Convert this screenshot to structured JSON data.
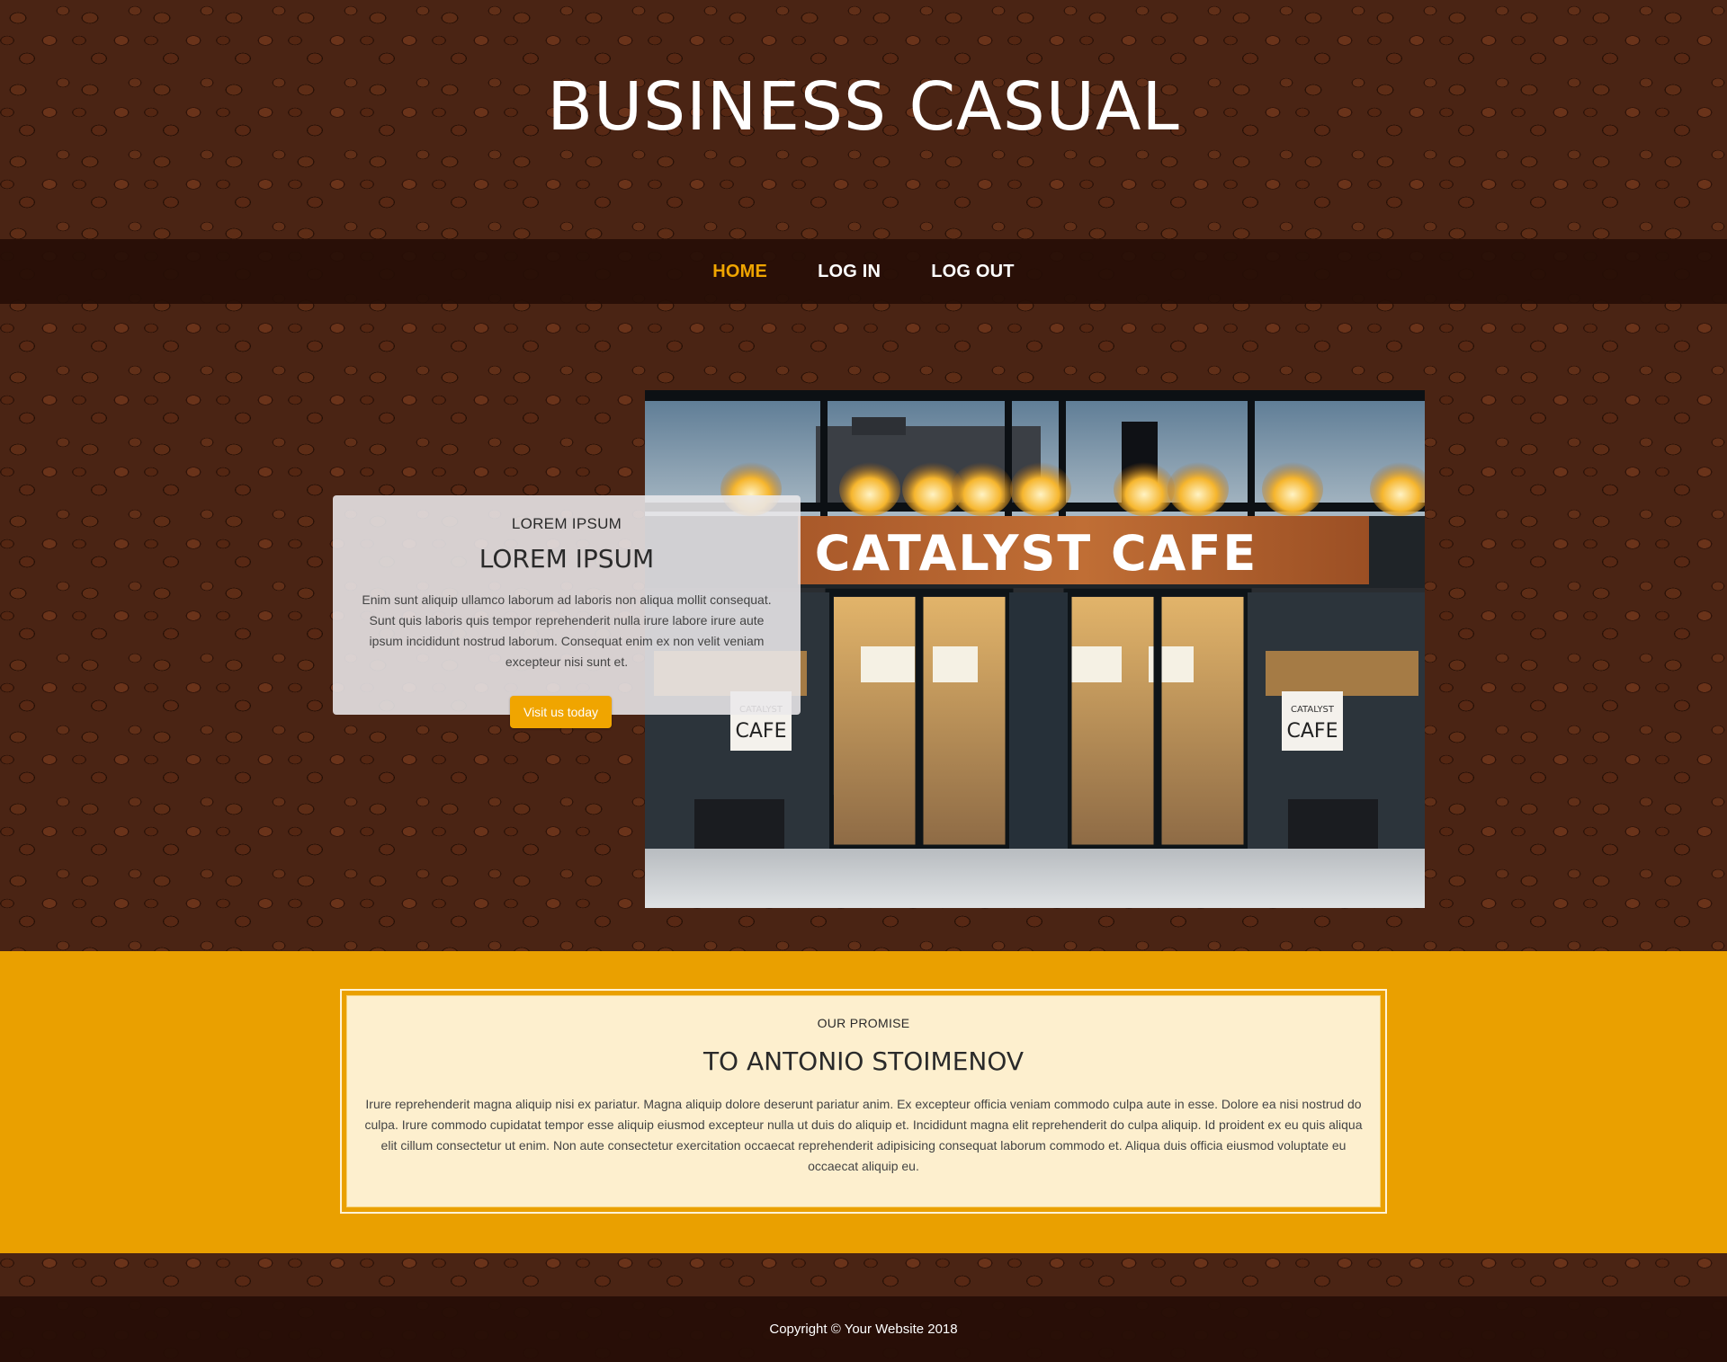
{
  "site": {
    "title": "BUSINESS CASUAL"
  },
  "nav": {
    "items": [
      {
        "label": "HOME",
        "active": true
      },
      {
        "label": "LOG IN",
        "active": false
      },
      {
        "label": "LOG OUT",
        "active": false
      }
    ]
  },
  "intro": {
    "subheading": "LOREM IPSUM",
    "heading": "LOREM IPSUM",
    "text": "Enim sunt aliquip ullamco laborum ad laboris non aliqua mollit consequat. Sunt quis laboris quis tempor reprehenderit nulla irure labore irure aute ipsum incididunt nostrud laborum. Consequat enim ex non velit veniam excepteur nisi sunt et.",
    "button_label": "Visit us today",
    "image": {
      "sign_text": "CATALYST CAFE",
      "window_sign_top": "CATALYST",
      "window_sign_bottom": "CAFE"
    }
  },
  "promise": {
    "subheading": "OUR PROMISE",
    "heading": "TO ANTONIO STOIMENOV",
    "text": "Irure reprehenderit magna aliquip nisi ex pariatur. Magna aliquip dolore deserunt pariatur anim. Ex excepteur officia veniam commodo culpa aute in esse. Dolore ea nisi nostrud do culpa. Irure commodo cupidatat tempor esse aliquip eiusmod excepteur nulla ut duis do aliquip et. Incididunt magna elit reprehenderit do culpa aliquip. Id proident ex eu quis aliqua elit cillum consectetur ut enim. Non aute consectetur exercitation occaecat reprehenderit adipisicing consequat laborum commodo et. Aliqua duis officia eiusmod voluptate eu occaecat aliquip eu."
  },
  "footer": {
    "copyright": "Copyright © Your Website 2018"
  },
  "colors": {
    "accent": "#f0a500",
    "nav_bg": "#260e06",
    "promise_bg": "#eaa000",
    "promise_card": "#fdefce",
    "background": "#4a2414"
  }
}
